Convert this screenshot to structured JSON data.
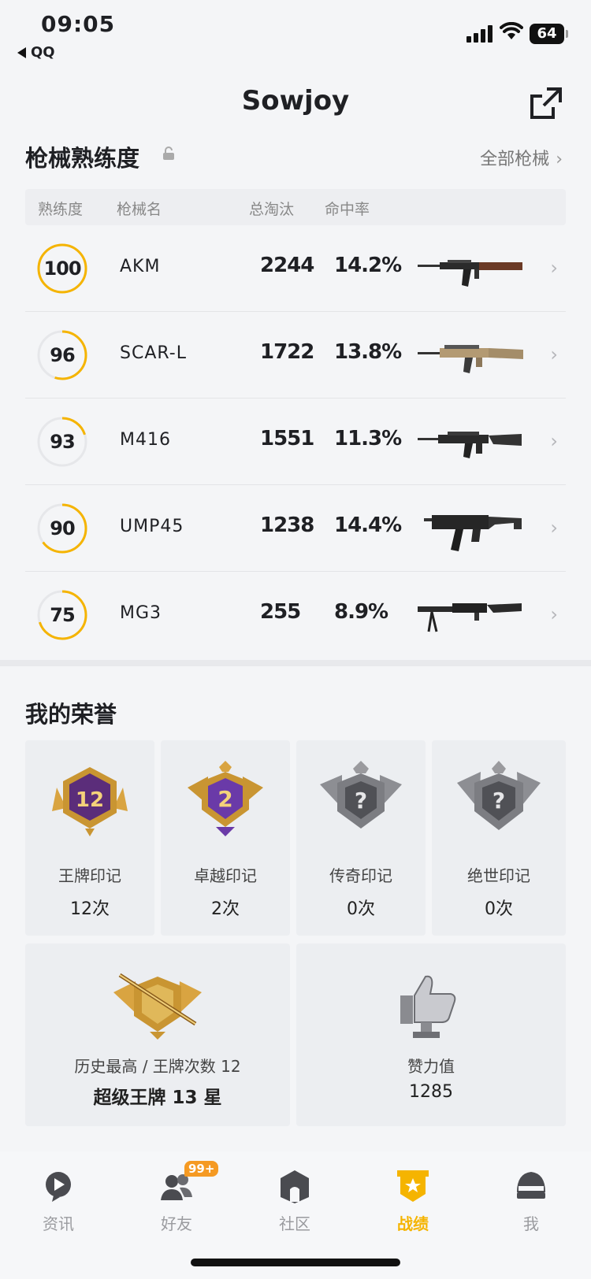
{
  "status": {
    "time": "09:05",
    "back_app": "QQ",
    "battery": "64"
  },
  "header": {
    "title": "Sowjoy"
  },
  "weapons": {
    "section_title": "枪械熟练度",
    "all_link": "全部枪械",
    "columns": [
      "熟练度",
      "枪械名",
      "总淘汰",
      "命中率"
    ],
    "rows": [
      {
        "proficiency": "100",
        "progress": 1.0,
        "name": "AKM",
        "kills": "2244",
        "accuracy": "14.2%"
      },
      {
        "proficiency": "96",
        "progress": 0.55,
        "name": "SCAR-L",
        "kills": "1722",
        "accuracy": "13.8%"
      },
      {
        "proficiency": "93",
        "progress": 0.2,
        "name": "M416",
        "kills": "1551",
        "accuracy": "11.3%"
      },
      {
        "proficiency": "90",
        "progress": 0.65,
        "name": "UMP45",
        "kills": "1238",
        "accuracy": "14.4%"
      },
      {
        "proficiency": "75",
        "progress": 0.7,
        "name": "MG3",
        "kills": "255",
        "accuracy": "8.9%"
      }
    ]
  },
  "honors": {
    "section_title": "我的荣誉",
    "marks": [
      {
        "label": "王牌印记",
        "count": "12次",
        "badge_number": "12"
      },
      {
        "label": "卓越印记",
        "count": "2次",
        "badge_number": "2"
      },
      {
        "label": "传奇印记",
        "count": "0次",
        "badge_number": "?"
      },
      {
        "label": "绝世印记",
        "count": "0次",
        "badge_number": "?"
      }
    ],
    "history": {
      "label": "历史最高 / 王牌次数 12",
      "value": "超级王牌 13 星"
    },
    "likes": {
      "label": "赞力值",
      "value": "1285"
    }
  },
  "tabbar": {
    "badge": "99+",
    "tabs": [
      {
        "label": "资讯",
        "icon": "news-icon"
      },
      {
        "label": "好友",
        "icon": "friends-icon"
      },
      {
        "label": "社区",
        "icon": "community-icon"
      },
      {
        "label": "战绩",
        "icon": "record-icon",
        "active": true
      },
      {
        "label": "我",
        "icon": "helmet-icon"
      }
    ]
  },
  "colors": {
    "accent": "#f5b400",
    "ring_track": "#e6e7ea"
  }
}
